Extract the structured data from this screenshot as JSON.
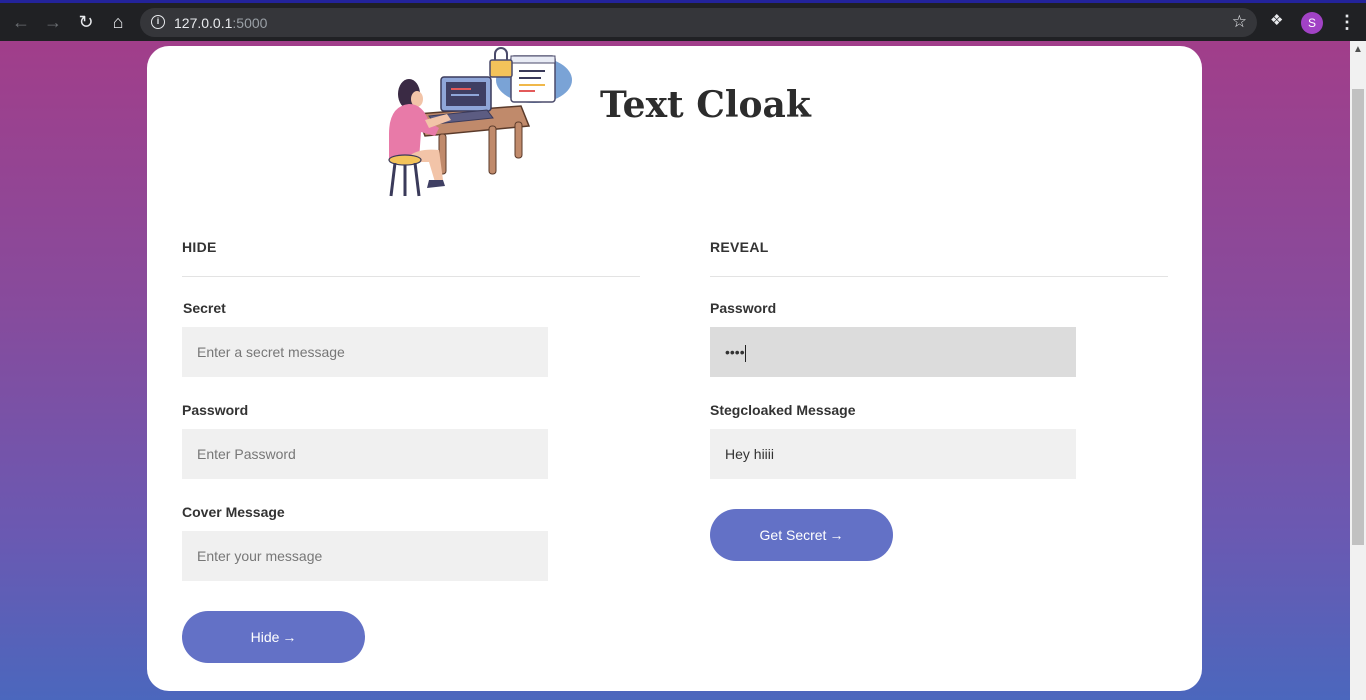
{
  "browser": {
    "url_host": "127.0.0.1",
    "url_port": ":5000",
    "profile_initial": "S"
  },
  "app": {
    "title": "Text Cloak"
  },
  "hide": {
    "section_title": "HIDE",
    "secret_label": "Secret",
    "secret_placeholder": "Enter a secret message",
    "password_label": "Password",
    "password_placeholder": "Enter Password",
    "cover_label": "Cover Message",
    "cover_placeholder": "Enter your message",
    "button_label": "Hide",
    "button_arrow": "→"
  },
  "reveal": {
    "section_title": "REVEAL",
    "password_label": "Password",
    "password_value": "••••",
    "message_label": "Stegcloaked Message",
    "message_value": "Hey hiiii",
    "button_label": "Get Secret",
    "button_arrow": "→"
  },
  "colors": {
    "button": "#6371c6",
    "gradient_top": "#a13e8a",
    "gradient_bottom": "#4b67bd"
  }
}
